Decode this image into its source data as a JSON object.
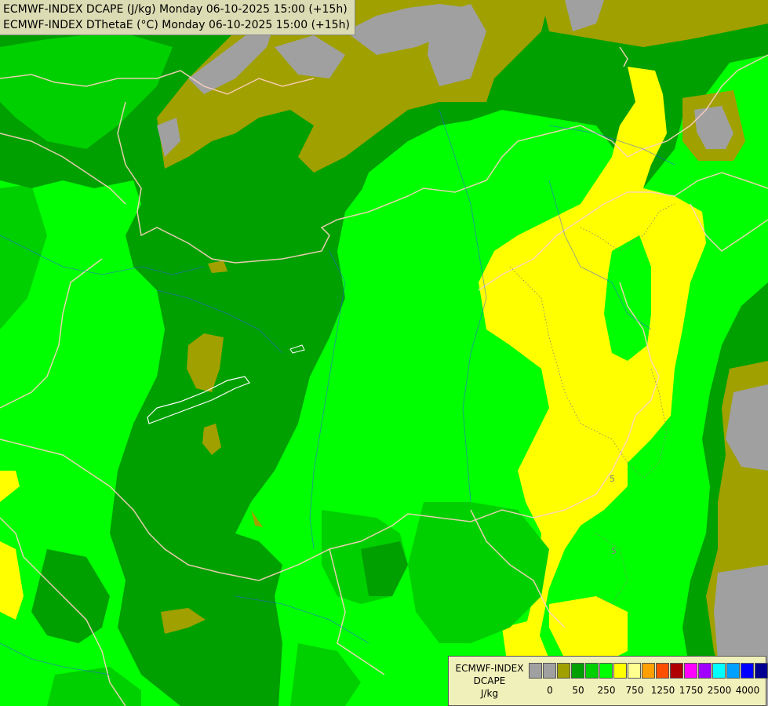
{
  "title": {
    "line1": "ECMWF-INDEX DCAPE (J/kg) Monday 06-10-2025 15:00 (+15h)",
    "line2": "ECMWF-INDEX DThetaE (°C) Monday 06-10-2025 15:00 (+15h)"
  },
  "legend": {
    "model": "ECMWF-INDEX",
    "param": "DCAPE",
    "unit": "J/kg",
    "colors": [
      "#a0a0a0",
      "#a0a0a0",
      "#a0a000",
      "#00a000",
      "#00d000",
      "#00ff00",
      "#ffff00",
      "#ffff90",
      "#ffa000",
      "#ff5000",
      "#b00000",
      "#ff00ff",
      "#a000ff",
      "#00ffff",
      "#00a0ff",
      "#0000ff",
      "#000090"
    ],
    "ticks": [
      {
        "label": "0",
        "index": 1
      },
      {
        "label": "50",
        "index": 3
      },
      {
        "label": "250",
        "index": 5
      },
      {
        "label": "750",
        "index": 7
      },
      {
        "label": "1250",
        "index": 9
      },
      {
        "label": "1750",
        "index": 11
      },
      {
        "label": "2500",
        "index": 13
      },
      {
        "label": "4000",
        "index": 15
      }
    ]
  },
  "contour_labels": [
    "5",
    "5"
  ]
}
